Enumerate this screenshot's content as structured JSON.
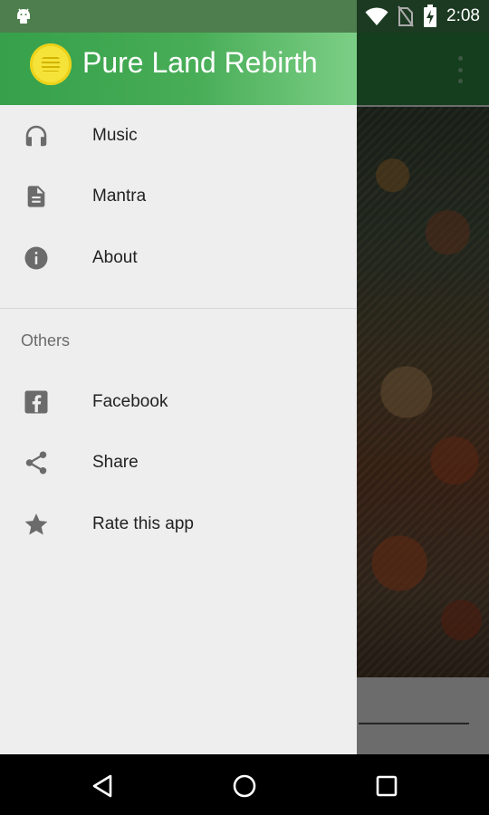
{
  "status_bar": {
    "time": "2:08",
    "icons": [
      "android-debug-icon",
      "wifi-icon",
      "no-sim-icon",
      "battery-charging-icon"
    ]
  },
  "drawer": {
    "app_title": "Pure Land Rebirth",
    "primary_items": [
      {
        "label": "Music",
        "icon": "headphones-icon"
      },
      {
        "label": "Mantra",
        "icon": "document-icon"
      },
      {
        "label": "About",
        "icon": "info-icon"
      }
    ],
    "section_label": "Others",
    "secondary_items": [
      {
        "label": "Facebook",
        "icon": "facebook-icon"
      },
      {
        "label": "Share",
        "icon": "share-icon"
      },
      {
        "label": "Rate this app",
        "icon": "star-icon"
      }
    ]
  },
  "nav_bar": {
    "buttons": [
      "back-icon",
      "home-icon",
      "recents-icon"
    ]
  },
  "colors": {
    "header_green": "#48ad57",
    "toolbar_green": "#2e8b43",
    "icon_gray": "#6b6b6b",
    "drawer_bg": "#eeeeee"
  }
}
